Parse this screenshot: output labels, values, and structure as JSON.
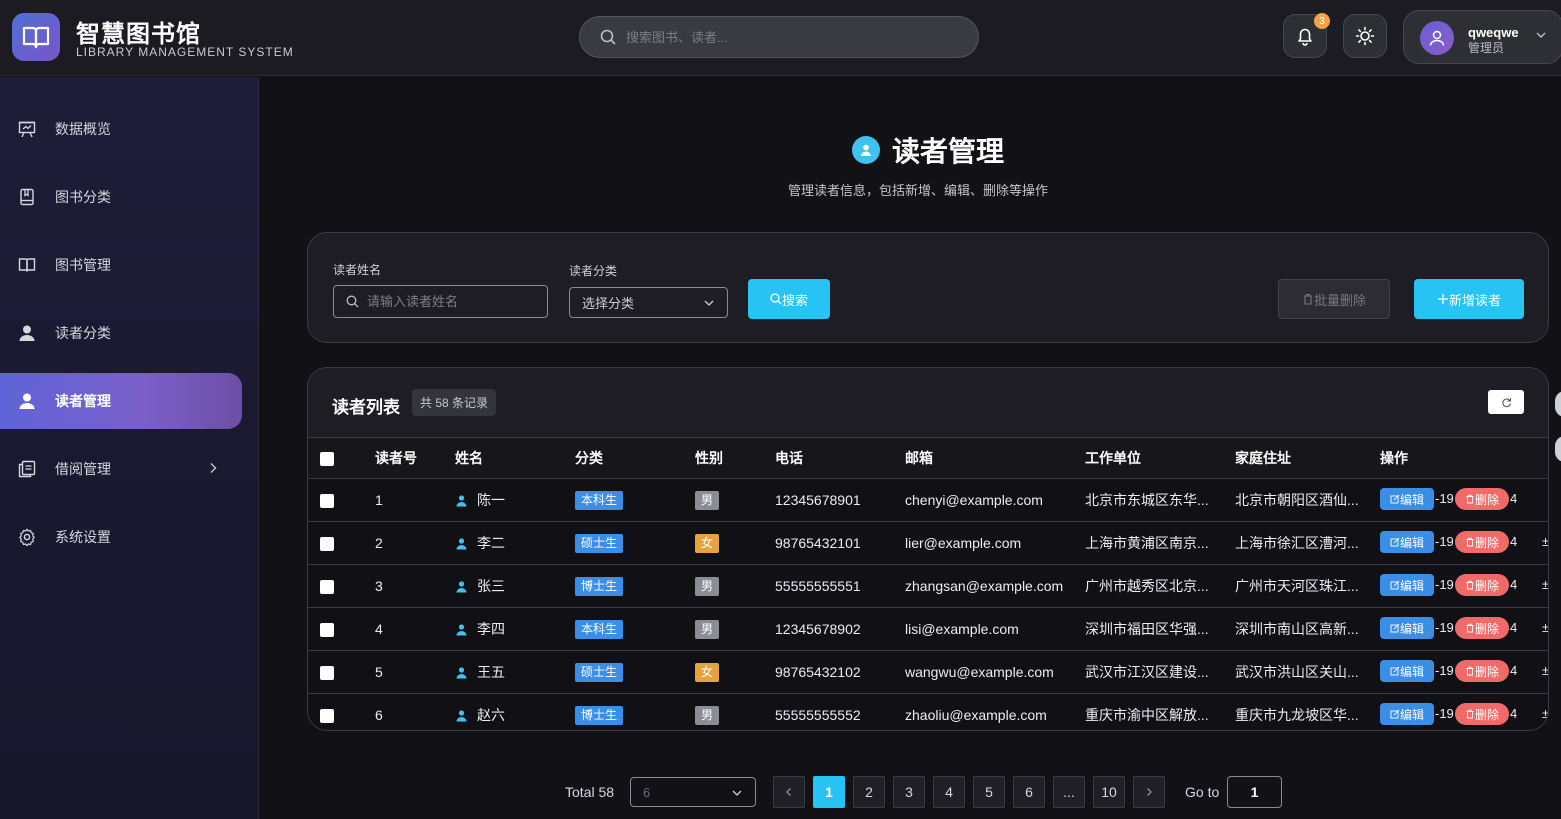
{
  "header": {
    "brand_title": "智慧图书馆",
    "brand_subtitle": "LIBRARY MANAGEMENT SYSTEM",
    "search_placeholder": "搜索图书、读者...",
    "notification_count": "3",
    "user_name": "qweqwe",
    "user_role": "管理员"
  },
  "sidebar": {
    "items": [
      {
        "label": "数据概览",
        "icon": "dashboard-icon"
      },
      {
        "label": "图书分类",
        "icon": "book-category-icon"
      },
      {
        "label": "图书管理",
        "icon": "open-book-icon"
      },
      {
        "label": "读者分类",
        "icon": "user-icon"
      },
      {
        "label": "读者管理",
        "icon": "user-icon",
        "active": true
      },
      {
        "label": "借阅管理",
        "icon": "borrow-icon",
        "has_submenu": true
      },
      {
        "label": "系统设置",
        "icon": "gear-icon"
      }
    ]
  },
  "page": {
    "title": "读者管理",
    "description": "管理读者信息，包括新增、编辑、删除等操作"
  },
  "filters": {
    "name_label": "读者姓名",
    "name_placeholder": "请输入读者姓名",
    "category_label": "读者分类",
    "category_placeholder": "选择分类",
    "search_button": "搜索",
    "bulk_delete_button": "批量删除",
    "add_button": "新增读者"
  },
  "table": {
    "title": "读者列表",
    "count_text": "共 58 条记录",
    "columns": [
      "读者号",
      "姓名",
      "分类",
      "性别",
      "电话",
      "邮箱",
      "工作单位",
      "家庭住址",
      "操作"
    ],
    "edit_label": "编辑",
    "delete_label": "删除",
    "rows": [
      {
        "id": "1",
        "name": "陈一",
        "category": "本科生",
        "gender": "男",
        "phone": "12345678901",
        "email": "chenyi@example.com",
        "work": "北京市东城区东华...",
        "address": "北京市朝阳区酒仙...",
        "extra": "-19",
        "extra2": "4",
        "extra3": ""
      },
      {
        "id": "2",
        "name": "李二",
        "category": "硕士生",
        "gender": "女",
        "phone": "98765432101",
        "email": "lier@example.com",
        "work": "上海市黄浦区南京...",
        "address": "上海市徐汇区漕河...",
        "extra": "-19",
        "extra2": "4",
        "extra3": "±"
      },
      {
        "id": "3",
        "name": "张三",
        "category": "博士生",
        "gender": "男",
        "phone": "55555555551",
        "email": "zhangsan@example.com",
        "work": "广州市越秀区北京...",
        "address": "广州市天河区珠江...",
        "extra": "-19",
        "extra2": "4",
        "extra3": "±"
      },
      {
        "id": "4",
        "name": "李四",
        "category": "本科生",
        "gender": "男",
        "phone": "12345678902",
        "email": "lisi@example.com",
        "work": "深圳市福田区华强...",
        "address": "深圳市南山区高新...",
        "extra": "-19",
        "extra2": "4",
        "extra3": "±"
      },
      {
        "id": "5",
        "name": "王五",
        "category": "硕士生",
        "gender": "女",
        "phone": "98765432102",
        "email": "wangwu@example.com",
        "work": "武汉市江汉区建设...",
        "address": "武汉市洪山区关山...",
        "extra": "-19",
        "extra2": "4",
        "extra3": "±"
      },
      {
        "id": "6",
        "name": "赵六",
        "category": "博士生",
        "gender": "男",
        "phone": "55555555552",
        "email": "zhaoliu@example.com",
        "work": "重庆市渝中区解放...",
        "address": "重庆市九龙坡区华...",
        "extra": "-19",
        "extra2": "4",
        "extra3": "±"
      }
    ]
  },
  "pagination": {
    "total_text": "Total 58",
    "page_size": "6",
    "pages": [
      "1",
      "2",
      "3",
      "4",
      "5",
      "6",
      "...",
      "10"
    ],
    "current_page": "1",
    "goto_label": "Go to",
    "goto_value": "1"
  },
  "colors": {
    "accent": "#27c3f5",
    "active_nav_start": "#5f64d8",
    "active_nav_end": "#7b5fc8",
    "tag_blue": "#3a8ee6",
    "tag_female": "#e6a23c",
    "tag_male": "#8c8c94",
    "delete": "#f06a6a"
  }
}
